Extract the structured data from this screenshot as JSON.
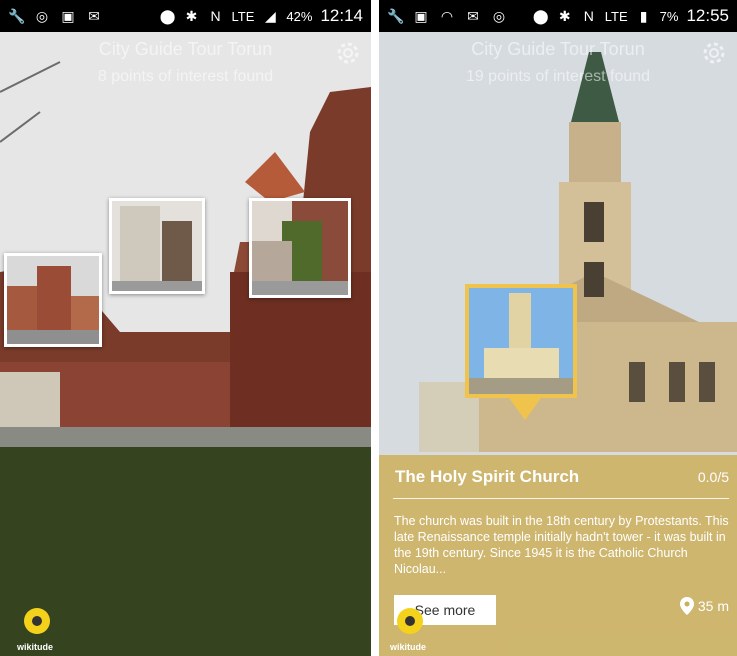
{
  "left_screen": {
    "status_bar": {
      "icons_left": [
        "wrench-icon",
        "sync-icon",
        "image-icon",
        "mail-icon"
      ],
      "icons_right": [
        "location-icon",
        "bluetooth-icon",
        "nfc-icon",
        "lte-icon",
        "signal-icon"
      ],
      "battery": "42%",
      "time": "12:14"
    },
    "header": {
      "title": "City Guide Tour Torun",
      "subtitle": "8 points of interest found"
    },
    "logo_text": "wikitude"
  },
  "right_screen": {
    "status_bar": {
      "icons_left": [
        "wrench-icon",
        "image-icon",
        "wifi-icon",
        "mail-icon",
        "sync-icon"
      ],
      "icons_right": [
        "location-icon",
        "bluetooth-icon",
        "nfc-icon",
        "lte-icon",
        "signal-icon"
      ],
      "battery": "7%",
      "time": "12:55"
    },
    "header": {
      "title": "City Guide Tour Torun",
      "subtitle": "19 points of interest found"
    },
    "poi_card": {
      "name": "The Holy Spirit Church",
      "rating": "0.0/5",
      "description": "The church was built in the 18th century by Protestants. This late Renaissance temple initially hadn't tower - it was built in the 19th century. Since 1945 it is the Catholic Church Nicolau...",
      "see_more_label": "See more",
      "distance": "35 m"
    },
    "logo_text": "wikitude"
  },
  "colors": {
    "accent": "#f0c44c",
    "panel": "#ccaf5a",
    "status_bar": "#000000"
  }
}
